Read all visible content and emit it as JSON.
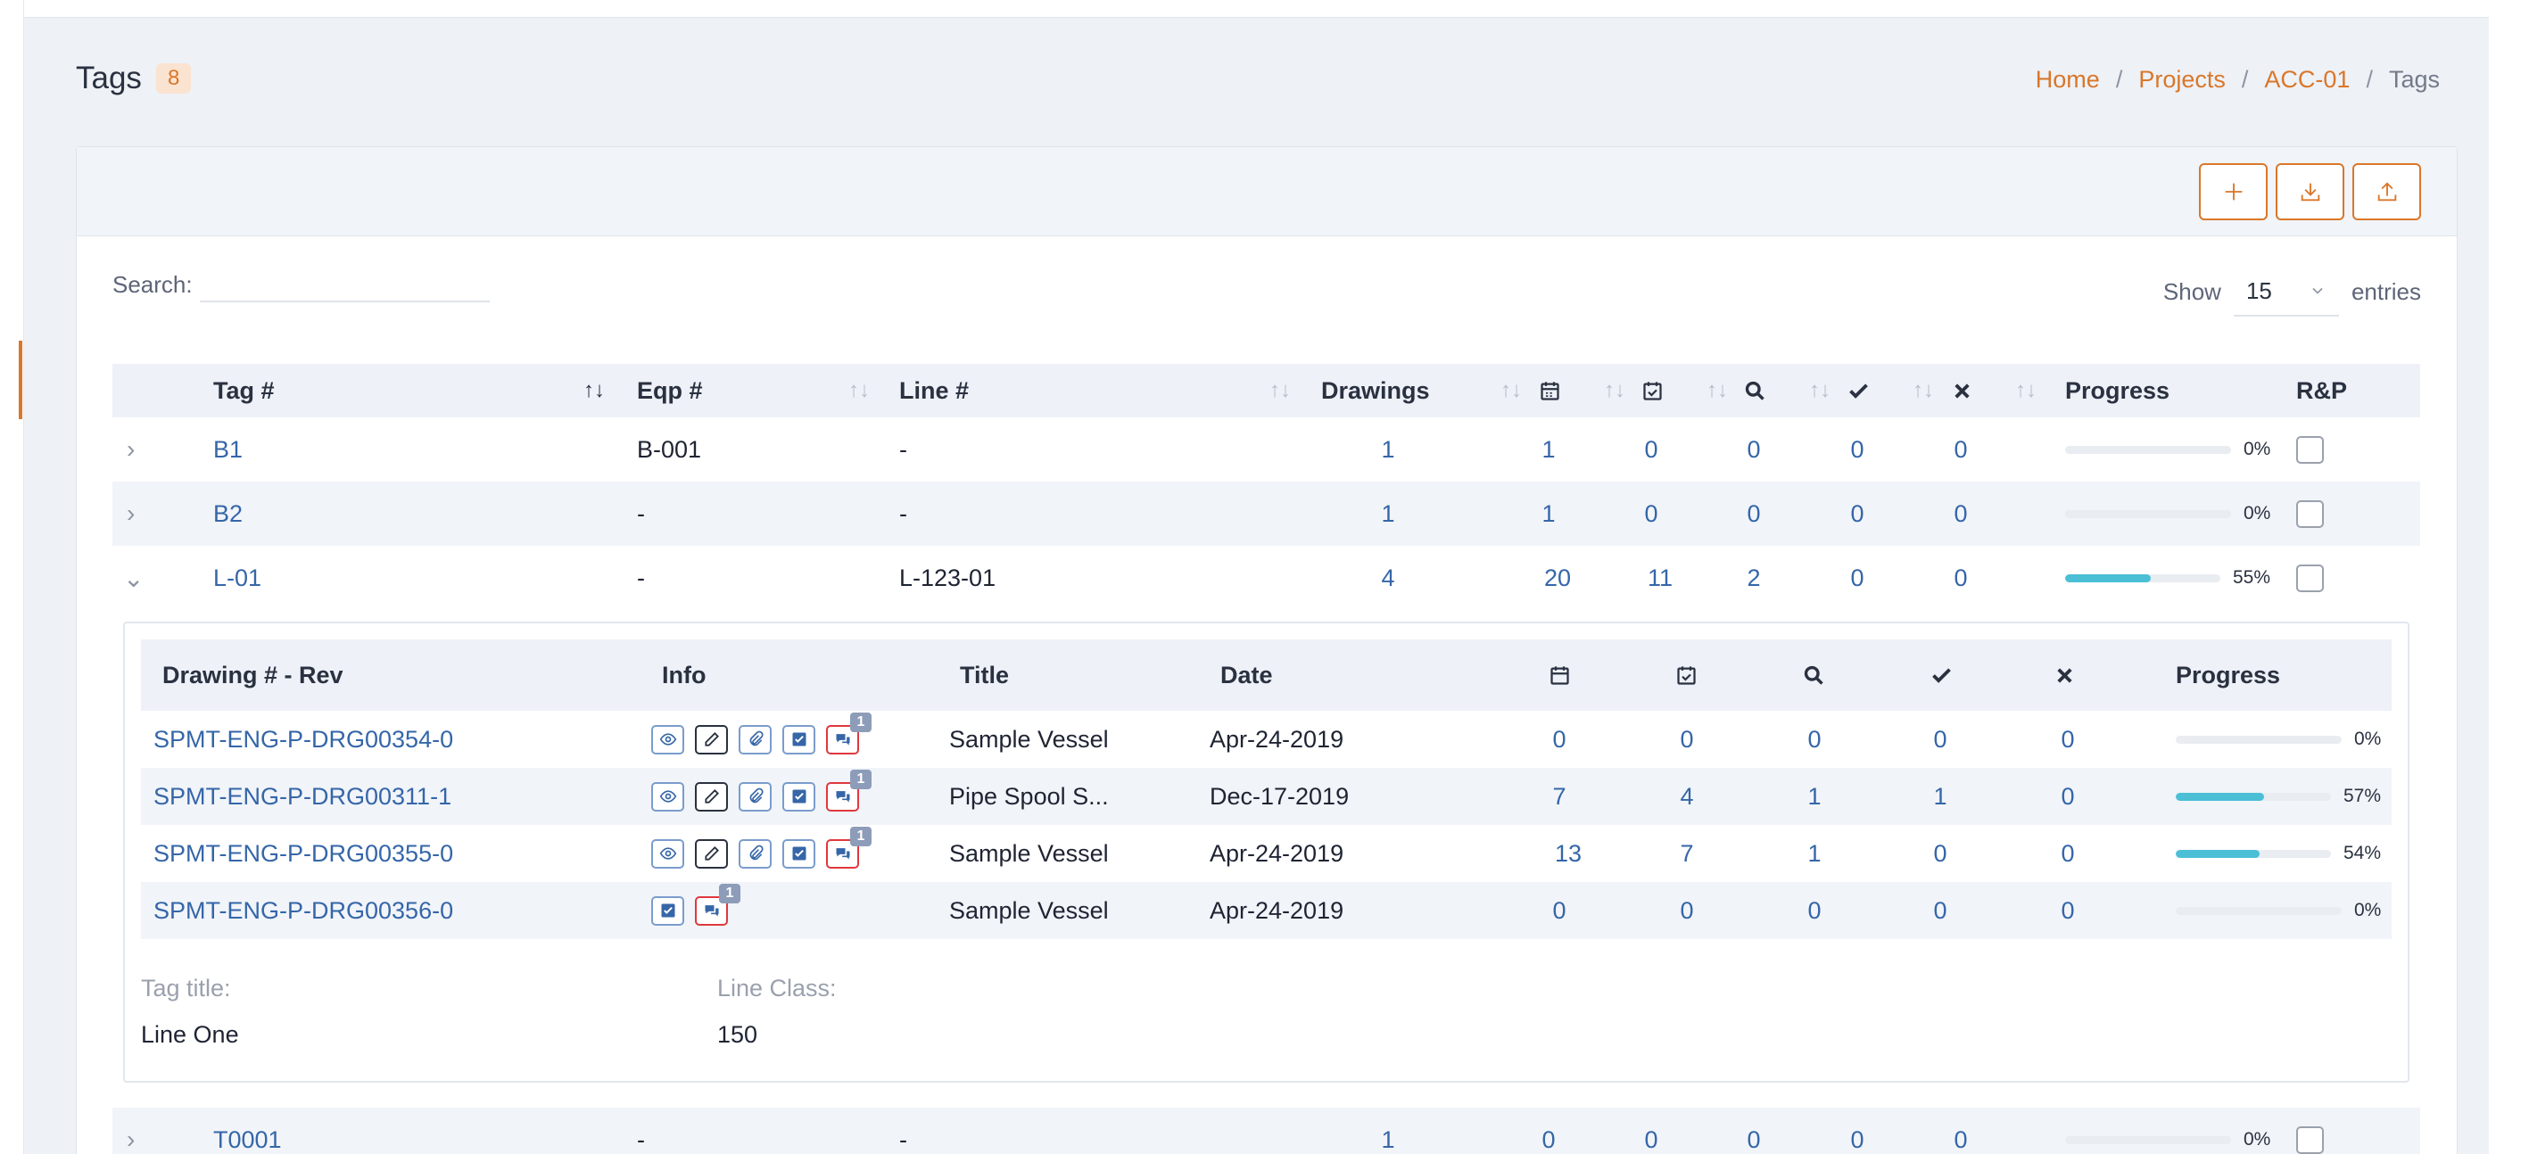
{
  "page": {
    "title": "Tags",
    "count": "8",
    "breadcrumb": {
      "home": "Home",
      "projects": "Projects",
      "project": "ACC-01",
      "current": "Tags"
    }
  },
  "toolbar": {
    "add_icon": "plus-icon",
    "import_icon": "download-icon",
    "export_icon": "upload-icon"
  },
  "search": {
    "label": "Search:",
    "value": "",
    "placeholder": ""
  },
  "show": {
    "label_before": "Show",
    "value": "15",
    "label_after": "entries"
  },
  "table": {
    "headers": {
      "tag": "Tag #",
      "eqp": "Eqp #",
      "line": "Line #",
      "drawings": "Drawings",
      "progress": "Progress",
      "rp": "R&P"
    },
    "icon_columns": [
      "calendar-icon",
      "calendar-check-icon",
      "search-icon",
      "check-icon",
      "x-icon"
    ],
    "rows": [
      {
        "tag": "B1",
        "eqp": "B-001",
        "line": "-",
        "drawings": "1",
        "c1": "1",
        "c2": "0",
        "c3": "0",
        "c4": "0",
        "c5": "0",
        "progress": 0,
        "progress_label": "0%",
        "expanded": false
      },
      {
        "tag": "B2",
        "eqp": "-",
        "line": "-",
        "drawings": "1",
        "c1": "1",
        "c2": "0",
        "c3": "0",
        "c4": "0",
        "c5": "0",
        "progress": 0,
        "progress_label": "0%",
        "expanded": false
      },
      {
        "tag": "L-01",
        "eqp": "-",
        "line": "L-123-01",
        "drawings": "4",
        "c1": "20",
        "c2": "11",
        "c3": "2",
        "c4": "0",
        "c5": "0",
        "progress": 55,
        "progress_label": "55%",
        "expanded": true
      },
      {
        "tag": "T0001",
        "eqp": "-",
        "line": "-",
        "drawings": "1",
        "c1": "0",
        "c2": "0",
        "c3": "0",
        "c4": "0",
        "c5": "0",
        "progress": 0,
        "progress_label": "0%",
        "expanded": false
      }
    ]
  },
  "drawings": {
    "headers": {
      "drawing": "Drawing # - Rev",
      "info": "Info",
      "title": "Title",
      "date": "Date",
      "progress": "Progress"
    },
    "rows": [
      {
        "drawing": "SPMT-ENG-P-DRG00354-0",
        "title": "Sample Vessel",
        "date": "Apr-24-2019",
        "c1": "0",
        "c2": "0",
        "c3": "0",
        "c4": "0",
        "c5": "0",
        "progress": 0,
        "progress_label": "0%",
        "comments": "1",
        "full_icons": true
      },
      {
        "drawing": "SPMT-ENG-P-DRG00311-1",
        "title": "Pipe Spool S...",
        "date": "Dec-17-2019",
        "c1": "7",
        "c2": "4",
        "c3": "1",
        "c4": "1",
        "c5": "0",
        "progress": 57,
        "progress_label": "57%",
        "comments": "1",
        "full_icons": true
      },
      {
        "drawing": "SPMT-ENG-P-DRG00355-0",
        "title": "Sample Vessel",
        "date": "Apr-24-2019",
        "c1": "13",
        "c2": "7",
        "c3": "1",
        "c4": "0",
        "c5": "0",
        "progress": 54,
        "progress_label": "54%",
        "comments": "1",
        "full_icons": true
      },
      {
        "drawing": "SPMT-ENG-P-DRG00356-0",
        "title": "Sample Vessel",
        "date": "Apr-24-2019",
        "c1": "0",
        "c2": "0",
        "c3": "0",
        "c4": "0",
        "c5": "0",
        "progress": 0,
        "progress_label": "0%",
        "comments": "1",
        "full_icons": false
      }
    ],
    "details": {
      "tag_title_label": "Tag title:",
      "tag_title": "Line One",
      "line_class_label": "Line Class:",
      "line_class": "150"
    }
  },
  "colors": {
    "accent": "#d9772a",
    "link": "#3566a8",
    "progress": "#4bbfd6",
    "alert": "#e0383e"
  }
}
